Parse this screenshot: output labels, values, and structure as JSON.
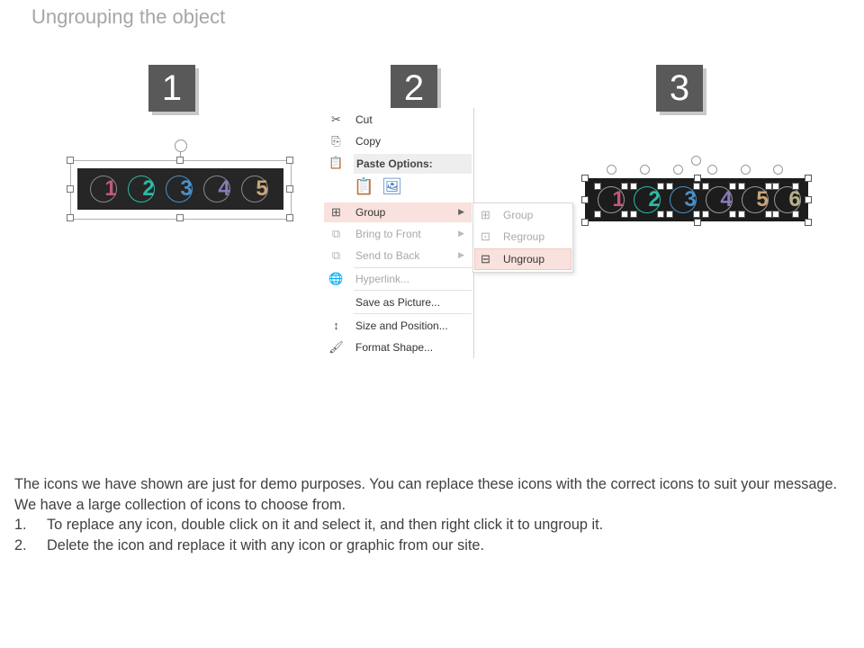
{
  "slide": {
    "title": "Ungrouping the object",
    "steps": [
      "1",
      "2",
      "3"
    ]
  },
  "panel1": {
    "digits": [
      "1",
      "2",
      "3",
      "4",
      "5"
    ],
    "colors": [
      "#c4577a",
      "#2fb8a2",
      "#4a90c8",
      "#8a7ab8",
      "#c9a57a"
    ]
  },
  "context_menu": {
    "items": [
      {
        "icon": "cut-icon",
        "label": "Cut",
        "disabled": false
      },
      {
        "icon": "copy-icon",
        "label": "Copy",
        "disabled": false
      },
      {
        "icon": "paste-icon",
        "label": "Paste Options:",
        "header": true
      },
      {
        "icon": "group-icon",
        "label": "Group",
        "highlighted": true,
        "submenu": true
      },
      {
        "icon": "bring-to-front-icon",
        "label": "Bring to Front",
        "disabled": true,
        "submenu": true
      },
      {
        "icon": "send-to-back-icon",
        "label": "Send to Back",
        "disabled": true,
        "submenu": true
      },
      {
        "icon": "hyperlink-icon",
        "label": "Hyperlink...",
        "disabled": true
      },
      {
        "icon": "save-picture-icon",
        "label": "Save as Picture...",
        "disabled": false
      },
      {
        "icon": "size-position-icon",
        "label": "Size and Position...",
        "disabled": false
      },
      {
        "icon": "format-shape-icon",
        "label": "Format Shape...",
        "disabled": false
      }
    ],
    "submenu": [
      {
        "icon": "group-icon",
        "label": "Group",
        "disabled": true
      },
      {
        "icon": "regroup-icon",
        "label": "Regroup",
        "disabled": true
      },
      {
        "icon": "ungroup-icon",
        "label": "Ungroup",
        "highlighted": true
      }
    ]
  },
  "panel3": {
    "digits": [
      "1",
      "2",
      "3",
      "4",
      "5",
      "6"
    ]
  },
  "body": {
    "intro": "The icons we have shown are just for demo purposes. You can replace these icons with the correct icons to suit your message. We have a large collection of icons to choose from.",
    "steps": [
      {
        "num": "1.",
        "text": "To replace any icon, double click on it and select it, and then right click it to ungroup it."
      },
      {
        "num": "2.",
        "text": "Delete the icon and replace it with any icon or graphic from our site."
      }
    ]
  }
}
